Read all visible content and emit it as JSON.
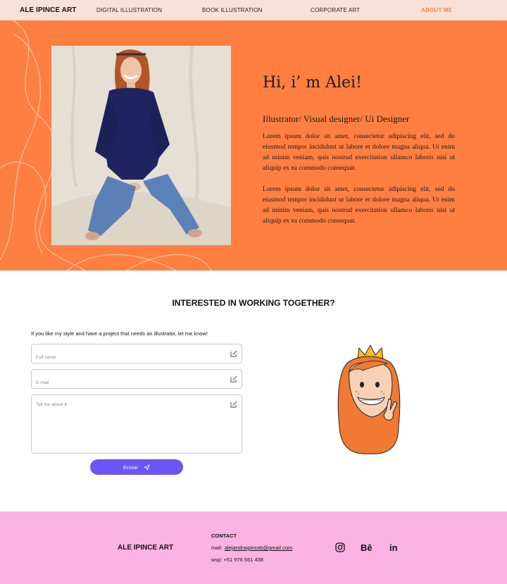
{
  "nav": {
    "logo": "ALE IPINCE ART",
    "links": [
      {
        "label": "DIGITAL ILLUSTRATION"
      },
      {
        "label": "BOOK ILLUSTRATION"
      },
      {
        "label": "CORPORATE ART"
      },
      {
        "label": "ABOUT ME"
      }
    ],
    "active_index": 3
  },
  "hero": {
    "greeting": "Hi, i’ m Alei!",
    "role": "Illustrator/ Visual designer/ Ui Designer",
    "paragraph_1": "Lorem ipsum dolor sit amet, consectetur adipiscing elit, sed do eiusmod tempor incididunt ut labore et dolore magna aliqua. Ut enim ad minim veniam, quis nostrud exercitation ullamco laboris nisi ut aliquip ex ea commodo consequat.",
    "paragraph_2": "Lorem ipsum dolor sit amet, consectetur adipiscing elit, sed do eiusmod tempor incididunt ut labore et dolore magna aliqua. Ut enim ad minim veniam, quis nostrud exercitation ullamco laboris nisi ut aliquip ex ea commodo consequat."
  },
  "contact_form": {
    "title": "INTERESTED IN WORKING TOGETHER?",
    "intro": "If you like my style and have a project that needs an illustrator, let me know!",
    "name_placeholder": "Full name",
    "email_placeholder": "E-mail",
    "message_placeholder": "Tell me about it",
    "send_label": "Enviar"
  },
  "footer": {
    "logo": "ALE IPINCE ART",
    "contact_title": "CONTACT",
    "mail_label": "mail:",
    "mail_value": "alejandraipinceb@gmail.com",
    "wsp": "wsp: +51 976 561 438",
    "behance_label": "Bē",
    "linkedin_label": "in"
  },
  "colors": {
    "nav_bg": "#f7e1d8",
    "hero_bg": "#ff7f41",
    "accent": "#ff7f41",
    "button": "#6b55f5",
    "footer_bg": "#fbb3e3"
  },
  "icons": [
    "edit-icon",
    "send-icon",
    "instagram-icon",
    "behance-icon",
    "linkedin-icon"
  ]
}
